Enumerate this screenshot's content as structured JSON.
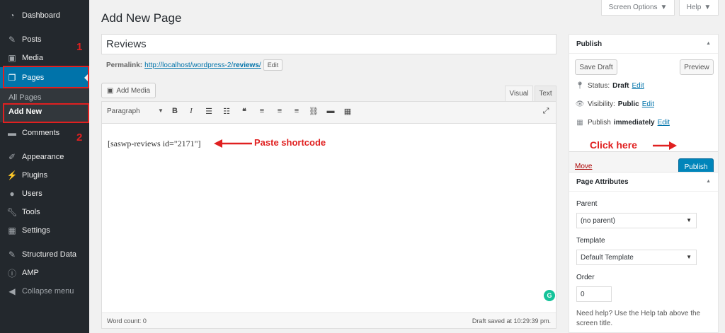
{
  "sidebar": {
    "items": [
      {
        "label": "Dashboard",
        "icon": "dashboard-icon"
      },
      {
        "label": "Posts",
        "icon": "pin-icon"
      },
      {
        "label": "Media",
        "icon": "media-icon"
      },
      {
        "label": "Pages",
        "icon": "pages-icon"
      },
      {
        "label": "Comments",
        "icon": "comments-icon"
      },
      {
        "label": "Appearance",
        "icon": "brush-icon"
      },
      {
        "label": "Plugins",
        "icon": "plugin-icon"
      },
      {
        "label": "Users",
        "icon": "users-icon"
      },
      {
        "label": "Tools",
        "icon": "wrench-icon"
      },
      {
        "label": "Settings",
        "icon": "settings-icon"
      },
      {
        "label": "Structured Data",
        "icon": "pin-icon"
      },
      {
        "label": "AMP",
        "icon": "amp-icon"
      },
      {
        "label": "Collapse menu",
        "icon": "collapse-icon"
      }
    ],
    "submenu": [
      "All Pages",
      "Add New"
    ],
    "annotation_1": "1",
    "annotation_2": "2"
  },
  "top": {
    "screen_options": "Screen Options",
    "help": "Help"
  },
  "main": {
    "page_title": "Add New Page",
    "title_value": "Reviews",
    "permalink_label": "Permalink:",
    "permalink_base": "http://localhost/wordpress-2/",
    "permalink_slug": "reviews",
    "permalink_trail": "/",
    "permalink_edit": "Edit",
    "add_media": "Add Media",
    "tab_visual": "Visual",
    "tab_text": "Text",
    "format": "Paragraph",
    "content": "[saswp-reviews id=\"2171\"]",
    "word_count": "Word count: 0",
    "draft_saved": "Draft saved at 10:29:39 pm."
  },
  "annotations": {
    "paste": "Paste shortcode",
    "click": "Click here"
  },
  "publish": {
    "title": "Publish",
    "save_draft": "Save Draft",
    "preview": "Preview",
    "status_label": "Status:",
    "status_value": "Draft",
    "visibility_label": "Visibility:",
    "visibility_value": "Public",
    "publish_label": "Publish",
    "publish_value": "immediately",
    "edit": "Edit",
    "move_trash": "Move",
    "publish_button": "Publish"
  },
  "attributes": {
    "title": "Page Attributes",
    "parent_label": "Parent",
    "parent_value": "(no parent)",
    "template_label": "Template",
    "template_value": "Default Template",
    "order_label": "Order",
    "order_value": "0",
    "help_text": "Need help? Use the Help tab above the screen title."
  },
  "colors": {
    "sidebar": "#23282d",
    "active": "#0073aa",
    "annotation": "#e02020",
    "publish_button": "#0085ba"
  }
}
